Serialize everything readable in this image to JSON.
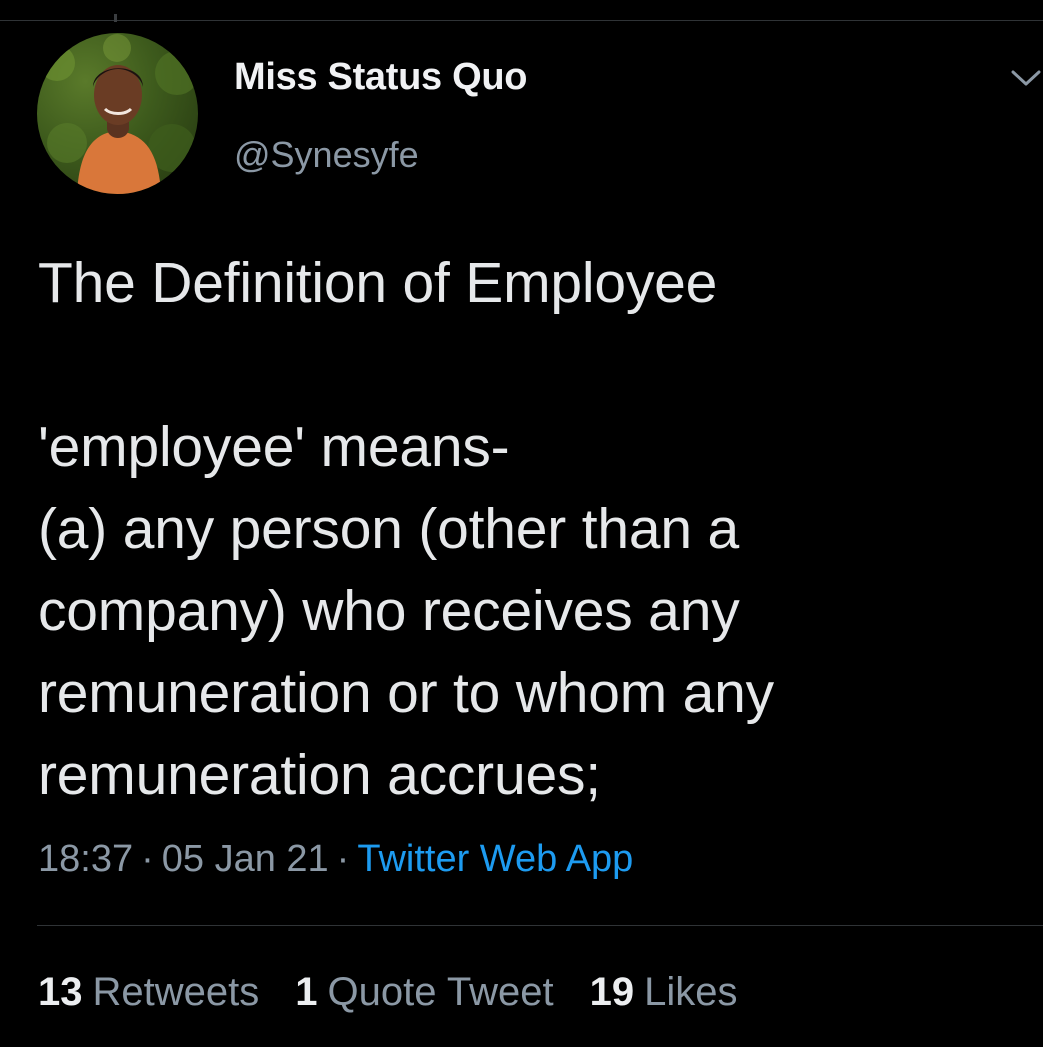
{
  "author": {
    "display_name": "Miss Status Quo",
    "handle": "@Synesyfe"
  },
  "tweet": {
    "lines": [
      "The Definition of Employee",
      "",
      "'employee' means-",
      "(a) any person (other than a",
      "company) who receives any",
      "remuneration or to whom any",
      "remuneration accrues;"
    ],
    "time": "18:37",
    "date": "05 Jan 21",
    "source": "Twitter Web App",
    "separator": "·"
  },
  "stats": {
    "retweets": {
      "count": "13",
      "label": "Retweets"
    },
    "quote_tweets": {
      "count": "1",
      "label": "Quote Tweet"
    },
    "likes": {
      "count": "19",
      "label": "Likes"
    }
  },
  "icons": {
    "menu": "chevron-down-icon",
    "avatar": "profile-photo"
  },
  "colors": {
    "background": "#000000",
    "text": "#e6e8ea",
    "secondary": "#8b98a5",
    "link": "#1d9bf0",
    "divider": "#2f3336"
  }
}
